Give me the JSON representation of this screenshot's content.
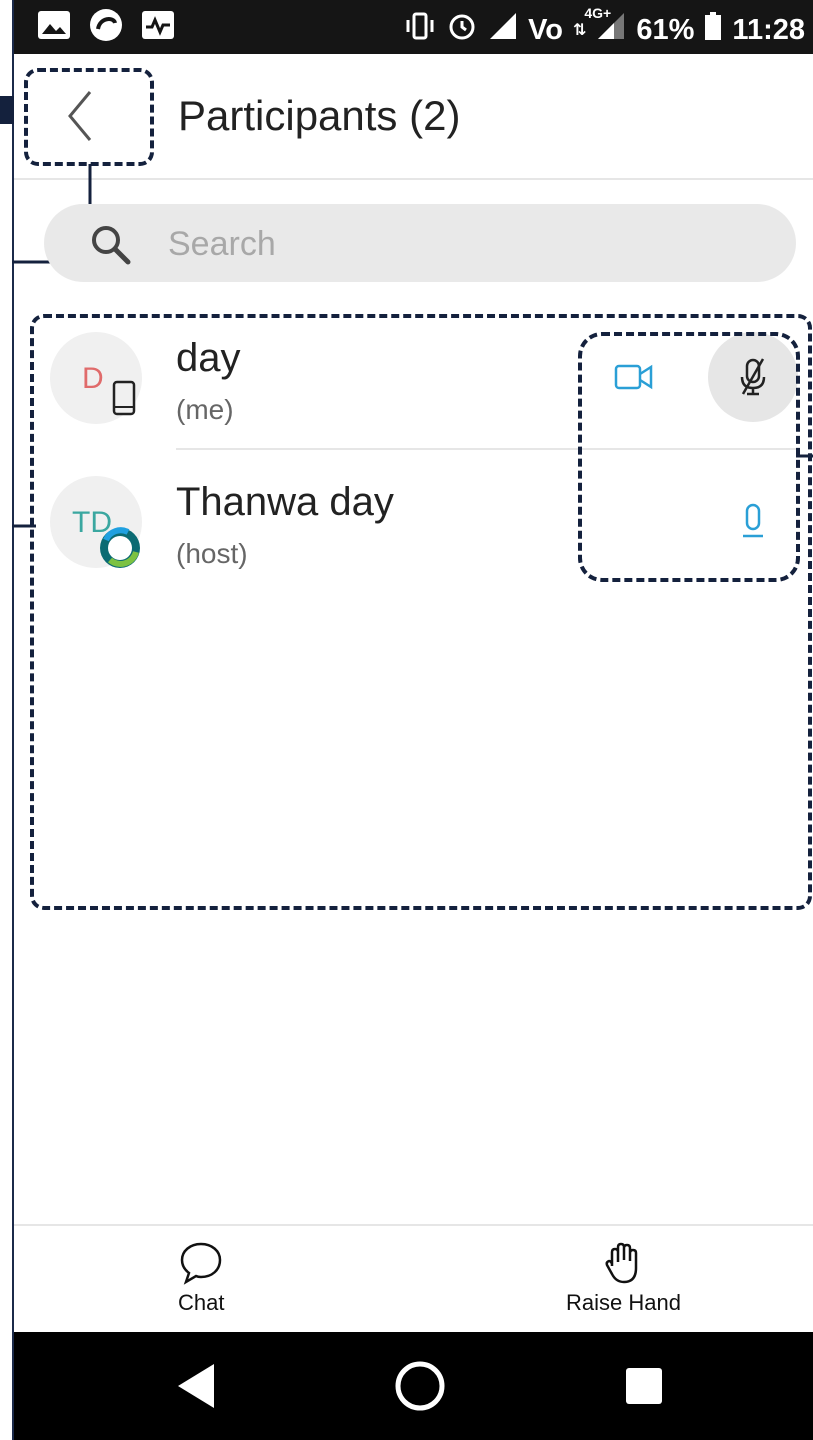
{
  "status_bar": {
    "battery": "61%",
    "time": "11:28",
    "network_text": "Vo",
    "network_badge": "4G+",
    "left_icons": [
      "image-icon",
      "sync-icon",
      "activity-icon"
    ],
    "right_icons": [
      "vibrate-icon",
      "alarm-icon",
      "signal-icon",
      "volte-icon",
      "data-arrows-icon",
      "signal-4g-icon",
      "battery-icon"
    ]
  },
  "header": {
    "title": "Participants (2)",
    "back_icon": "chevron-left-icon"
  },
  "search": {
    "placeholder": "Search",
    "value": ""
  },
  "participants": [
    {
      "initials": "D",
      "initials_color": "#e06b6b",
      "badge_icon": "phone-icon",
      "name": "day",
      "role": "(me)",
      "video_icon": "video-camera-icon",
      "mic_icon": "mic-muted-icon"
    },
    {
      "initials": "TD",
      "initials_color": "#3aa7a0",
      "badge_icon": "webex-logo-icon",
      "name": "Thanwa day",
      "role": "(host)",
      "mic_icon": "mic-icon"
    }
  ],
  "bottom_bar": {
    "chat_label": "Chat",
    "raise_hand_label": "Raise Hand"
  },
  "nav_bar": {
    "back_icon": "nav-back-icon",
    "home_icon": "nav-home-icon",
    "recents_icon": "nav-recents-icon"
  },
  "colors": {
    "accent_blue": "#2a9fd6",
    "annotation": "#14213d",
    "status_bar_bg": "#151515"
  }
}
